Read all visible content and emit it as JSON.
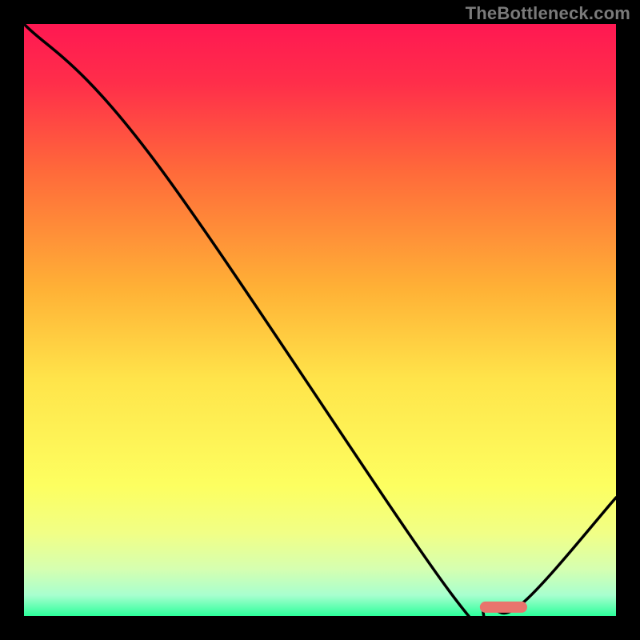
{
  "watermark": "TheBottleneck.com",
  "chart_data": {
    "type": "line",
    "title": "",
    "xlabel": "",
    "ylabel": "",
    "xlim": [
      0,
      100
    ],
    "ylim": [
      0,
      100
    ],
    "grid": false,
    "legend": false,
    "series": [
      {
        "name": "curve",
        "x": [
          0,
          22,
          72,
          78,
          84,
          100
        ],
        "y": [
          100,
          77,
          4,
          2,
          2,
          20
        ]
      }
    ],
    "marker": {
      "name": "optimum",
      "x_start": 77,
      "x_end": 85,
      "y": 1.5,
      "color": "#e9746d"
    },
    "gradient_stops": [
      {
        "offset": 0.0,
        "color": "#ff1852"
      },
      {
        "offset": 0.1,
        "color": "#ff2e4a"
      },
      {
        "offset": 0.25,
        "color": "#ff6a3a"
      },
      {
        "offset": 0.45,
        "color": "#ffb236"
      },
      {
        "offset": 0.6,
        "color": "#ffe44a"
      },
      {
        "offset": 0.78,
        "color": "#fdff60"
      },
      {
        "offset": 0.86,
        "color": "#f1ff86"
      },
      {
        "offset": 0.92,
        "color": "#d6ffb0"
      },
      {
        "offset": 0.965,
        "color": "#a8ffcf"
      },
      {
        "offset": 1.0,
        "color": "#2cff9b"
      }
    ]
  }
}
